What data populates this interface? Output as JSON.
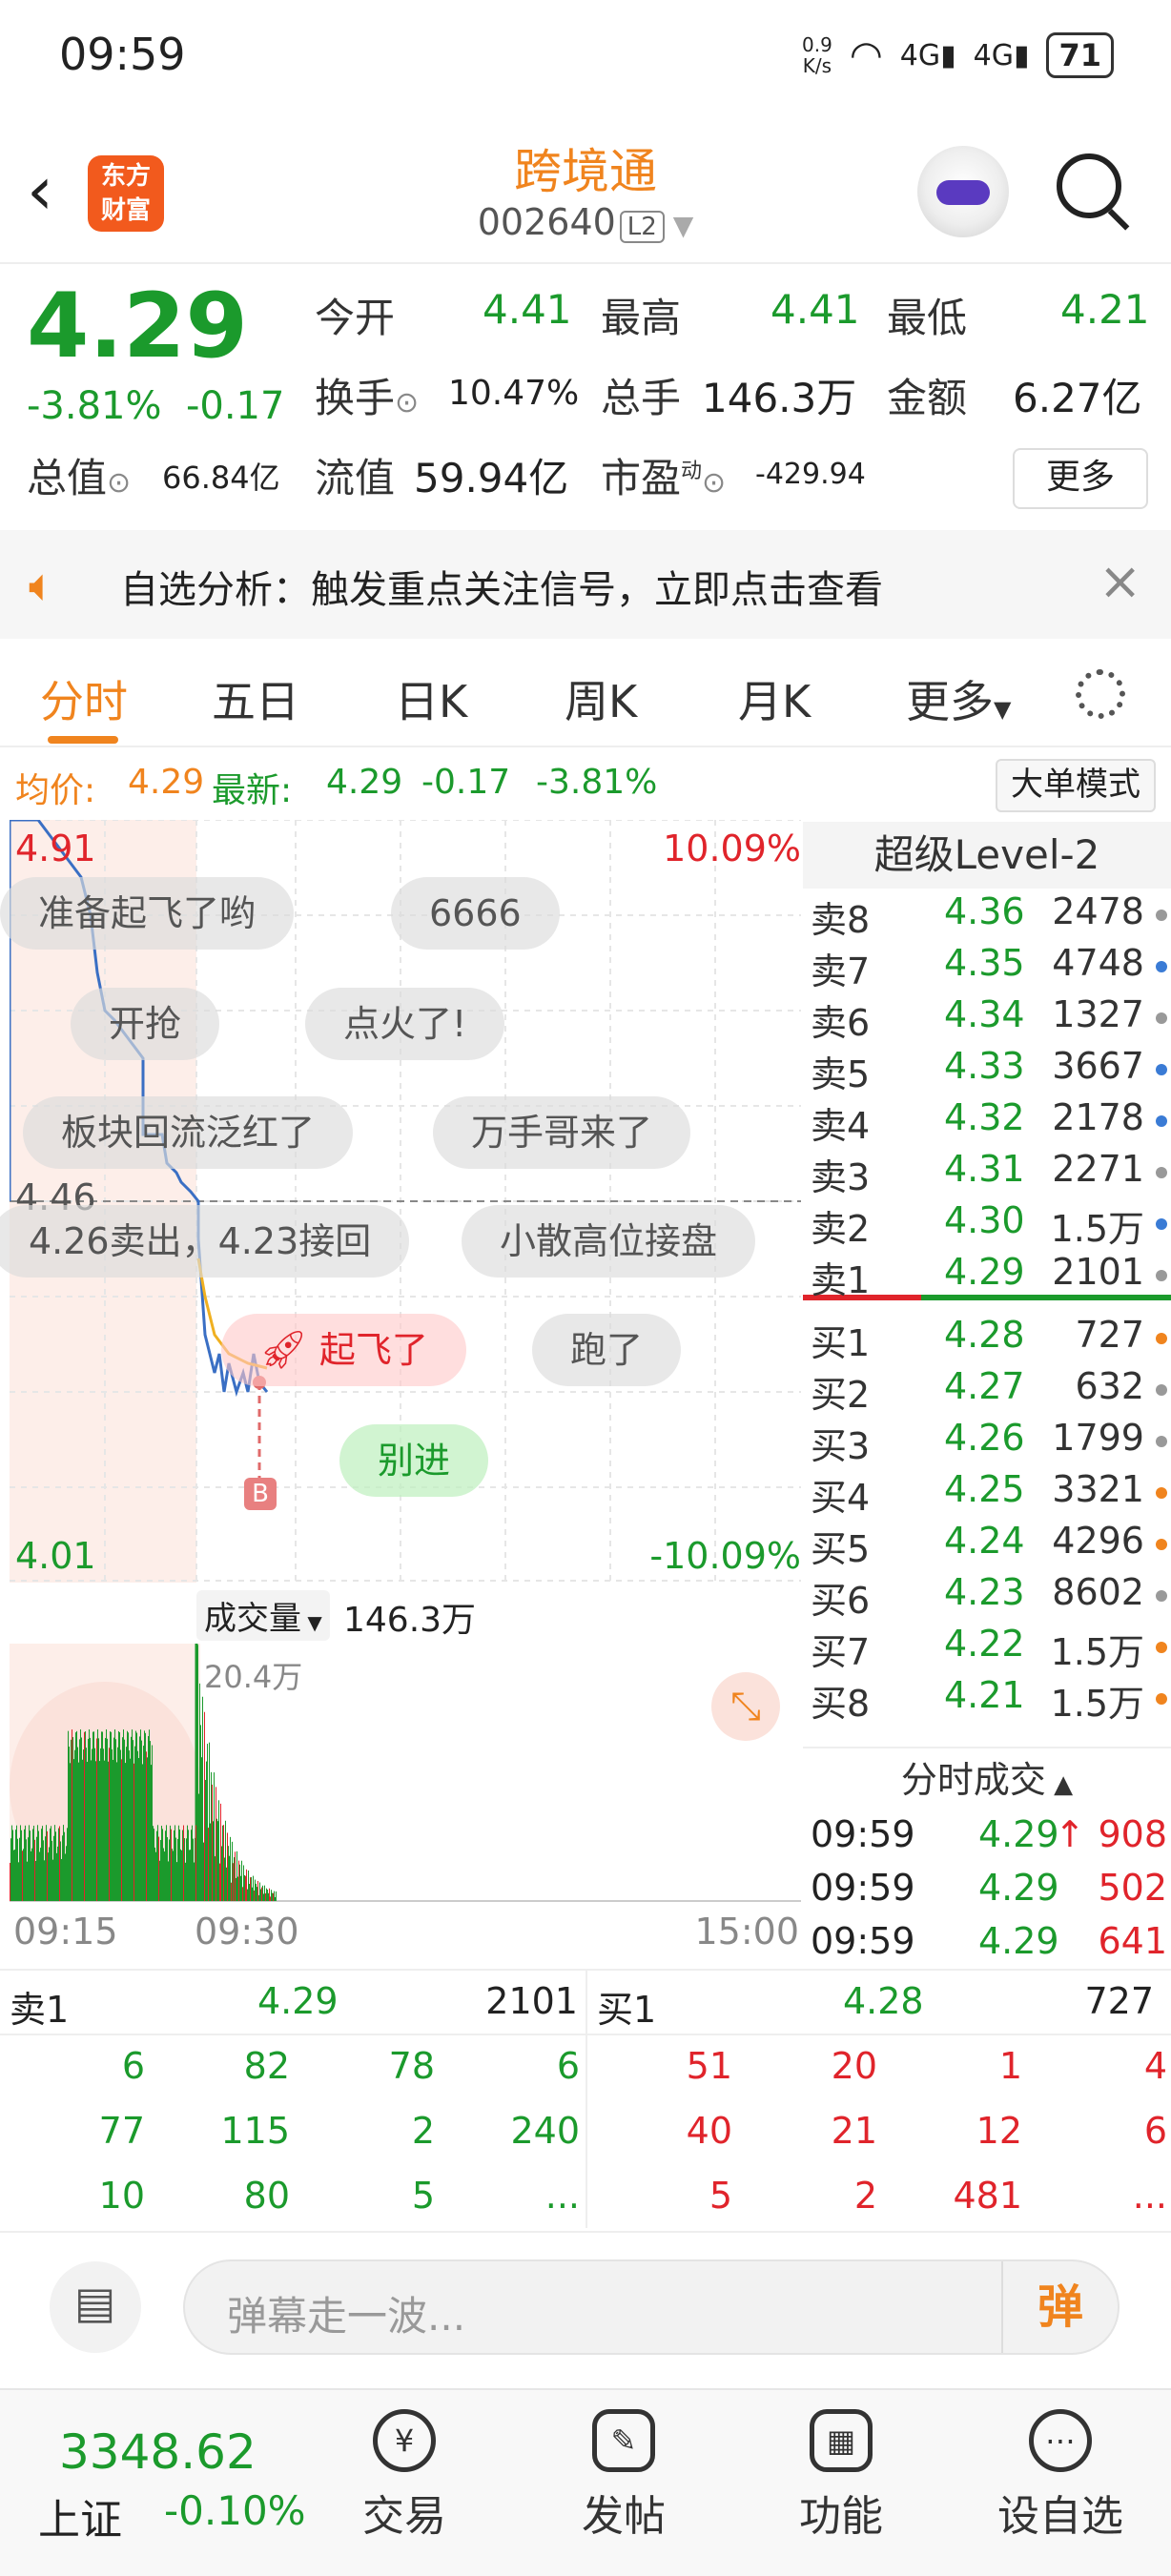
{
  "status": {
    "time": "09:59",
    "net_speed": "0.9\nK/s",
    "sig1": "4G",
    "sig2": "4G",
    "battery": "71"
  },
  "header": {
    "name": "跨境通",
    "code": "002640",
    "level": "L2",
    "logo": "东方\n财富"
  },
  "quote": {
    "price": "4.29",
    "change_pct": "-3.81%",
    "change": "-0.17",
    "open_label": "今开",
    "open": "4.41",
    "high_label": "最高",
    "high": "4.41",
    "low_label": "最低",
    "low": "4.21",
    "turnover_label": "换手",
    "turnover": "10.47%",
    "volume_label": "总手",
    "volume": "146.3万",
    "amount_label": "金额",
    "amount": "6.27亿",
    "mktcap_label": "总值",
    "mktcap": "66.84亿",
    "float_label": "流值",
    "float": "59.94亿",
    "pe_label": "市盈",
    "pe_sup": "动",
    "pe": "-429.94",
    "more": "更多"
  },
  "notice": {
    "text": "自选分析：触发重点关注信号，立即点击查看"
  },
  "tabs": [
    "分时",
    "五日",
    "日K",
    "周K",
    "月K",
    "更多"
  ],
  "info": {
    "avg_label": "均价:",
    "avg": "4.29",
    "latest_label": "最新:",
    "latest": "4.29",
    "chg": "-0.17",
    "pct": "-3.81%",
    "bigorder": "大单模式"
  },
  "chart": {
    "high_price": "4.91",
    "mid_price": "4.46",
    "low_price": "4.01",
    "top_pct": "10.09%",
    "bottom_pct": "-10.09%",
    "vol_label": "成交量",
    "vol_total": "146.3万",
    "vol_max": "20.4万",
    "t_start": "09:15",
    "t_mid": "09:30",
    "t_end": "15:00",
    "marker": "B"
  },
  "danmu": [
    "准备起飞了哟",
    "6666",
    "开抢",
    "点火了!",
    "板块回流泛红了",
    "万手哥来了",
    "4.26卖出，4.23接回",
    "小散高位接盘",
    "起飞了",
    "跑了",
    "别进"
  ],
  "book": {
    "title": "超级Level-2",
    "asks": [
      {
        "label": "卖8",
        "price": "4.36",
        "vol": "2478",
        "dot": "#999"
      },
      {
        "label": "卖7",
        "price": "4.35",
        "vol": "4748",
        "dot": "#3a7bd5"
      },
      {
        "label": "卖6",
        "price": "4.34",
        "vol": "1327",
        "dot": "#999"
      },
      {
        "label": "卖5",
        "price": "4.33",
        "vol": "3667",
        "dot": "#3a7bd5"
      },
      {
        "label": "卖4",
        "price": "4.32",
        "vol": "2178",
        "dot": "#3a7bd5"
      },
      {
        "label": "卖3",
        "price": "4.31",
        "vol": "2271",
        "dot": "#999"
      },
      {
        "label": "卖2",
        "price": "4.30",
        "vol": "1.5万",
        "dot": "#3a7bd5"
      },
      {
        "label": "卖1",
        "price": "4.29",
        "vol": "2101",
        "dot": "#999"
      }
    ],
    "bids": [
      {
        "label": "买1",
        "price": "4.28",
        "vol": "727",
        "dot": "#f0841e"
      },
      {
        "label": "买2",
        "price": "4.27",
        "vol": "632",
        "dot": "#999"
      },
      {
        "label": "买3",
        "price": "4.26",
        "vol": "1799",
        "dot": "#999"
      },
      {
        "label": "买4",
        "price": "4.25",
        "vol": "3321",
        "dot": "#f0841e"
      },
      {
        "label": "买5",
        "price": "4.24",
        "vol": "4296",
        "dot": "#f0841e"
      },
      {
        "label": "买6",
        "price": "4.23",
        "vol": "8602",
        "dot": "#999"
      },
      {
        "label": "买7",
        "price": "4.22",
        "vol": "1.5万",
        "dot": "#f0841e"
      },
      {
        "label": "买8",
        "price": "4.21",
        "vol": "1.5万",
        "dot": "#f0841e"
      }
    ]
  },
  "ticks": {
    "title": "分时成交",
    "rows": [
      {
        "time": "09:59",
        "price": "4.29",
        "arrow": "↑",
        "vol": "908"
      },
      {
        "time": "09:59",
        "price": "4.29",
        "arrow": "",
        "vol": "502"
      },
      {
        "time": "09:59",
        "price": "4.29",
        "arrow": "",
        "vol": "641"
      }
    ]
  },
  "level1": {
    "ask_label": "卖1",
    "ask_price": "4.29",
    "ask_vol": "2101",
    "bid_label": "买1",
    "bid_price": "4.28",
    "bid_vol": "727",
    "ask_queue": [
      [
        "6",
        "82",
        "78",
        "6"
      ],
      [
        "77",
        "115",
        "2",
        "240"
      ],
      [
        "10",
        "80",
        "5",
        "..."
      ]
    ],
    "bid_queue": [
      [
        "51",
        "20",
        "1",
        "4"
      ],
      [
        "40",
        "21",
        "12",
        "6"
      ],
      [
        "5",
        "2",
        "481",
        "..."
      ]
    ]
  },
  "input": {
    "placeholder": "弹幕走一波...",
    "btn": "弹"
  },
  "nav": {
    "index_value": "3348.62",
    "index_name": "上证",
    "index_pct": "-0.10%",
    "items": [
      "交易",
      "发帖",
      "功能",
      "设自选"
    ]
  }
}
